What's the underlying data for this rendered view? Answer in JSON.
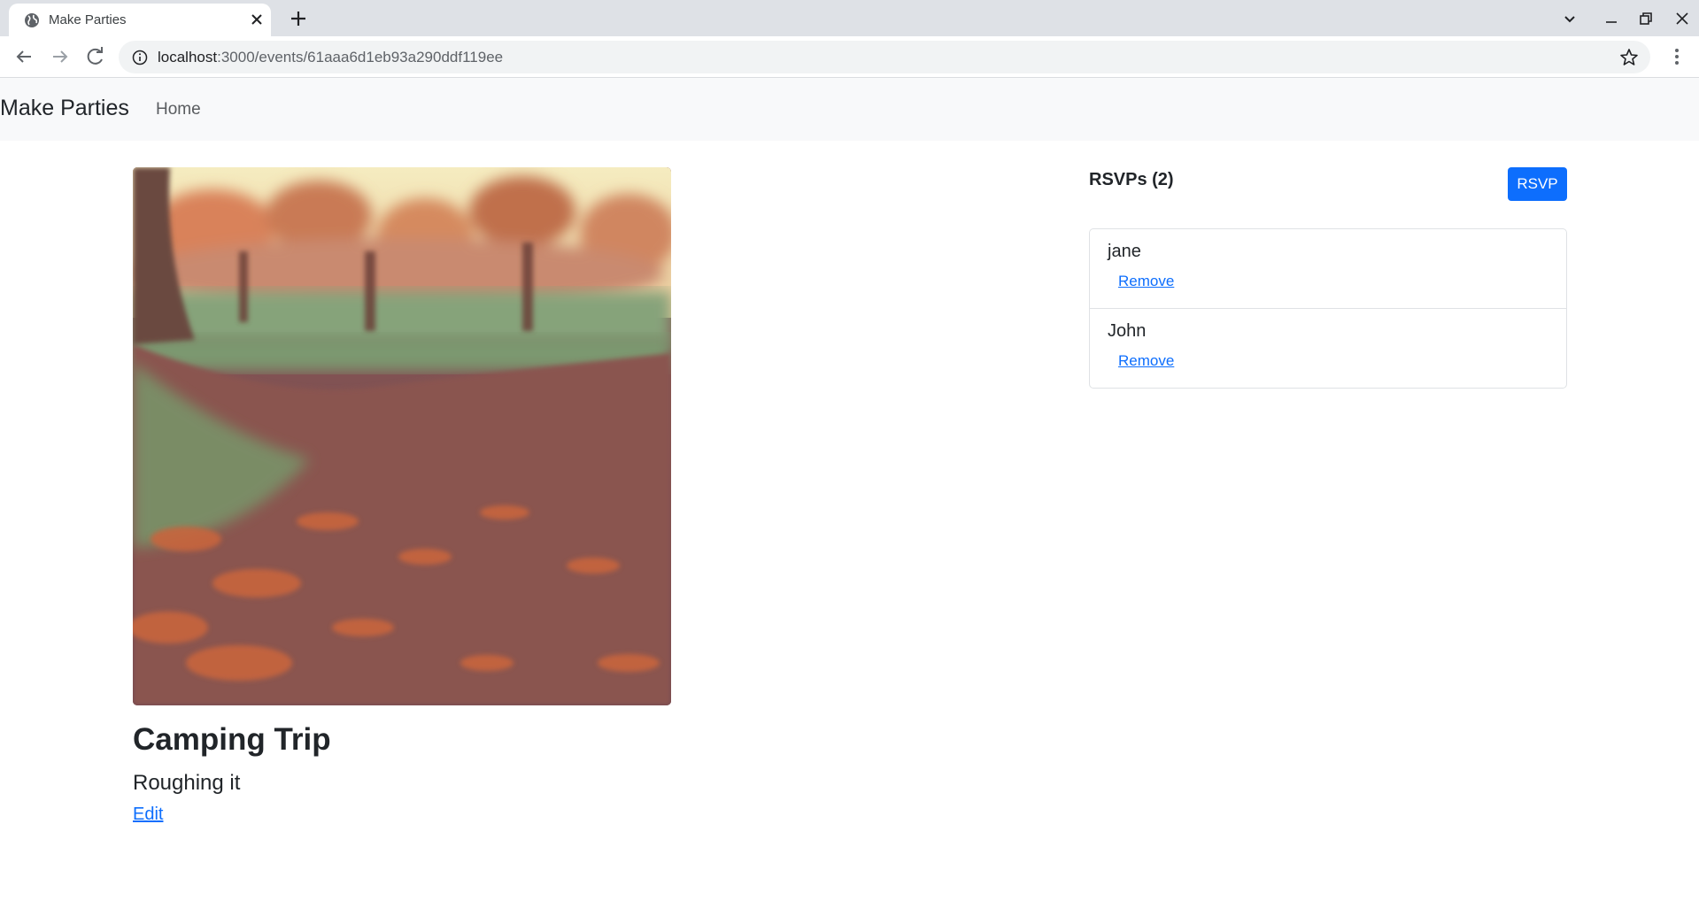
{
  "browser": {
    "tab_title": "Make Parties",
    "url_host": "localhost",
    "url_path": ":3000/events/61aaa6d1eb93a290ddf119ee"
  },
  "app": {
    "brand": "Make Parties",
    "nav": {
      "home_label": "Home"
    }
  },
  "event": {
    "title": "Camping Trip",
    "description": "Roughing it",
    "edit_label": "Edit",
    "image_icon": "autumn-path-photo"
  },
  "rsvps": {
    "heading": "RSVPs (2)",
    "button_label": "RSVP",
    "items": [
      {
        "name": "jane",
        "remove_label": "Remove"
      },
      {
        "name": "John",
        "remove_label": "Remove"
      }
    ]
  },
  "colors": {
    "primary": "#0d6efd",
    "navbar_bg": "#f8f9fa",
    "tabstrip_bg": "#dee1e6"
  }
}
